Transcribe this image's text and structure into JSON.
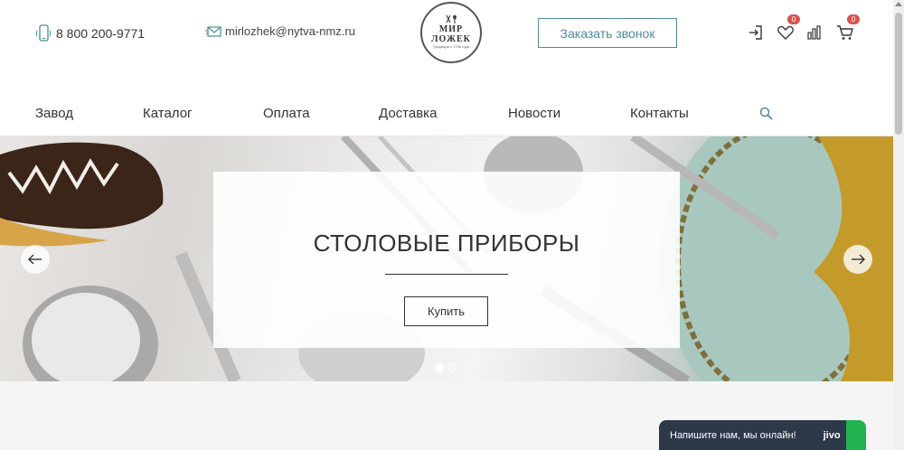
{
  "header": {
    "phone": "8 800 200-9771",
    "email": "mirlozhek@nytva-nmz.ru",
    "logo": {
      "line1": "МИР",
      "line2": "ЛОЖЕК",
      "tagline": "Традиции с 1756 года"
    },
    "callback_label": "Заказать звонок",
    "favorites_count": "0",
    "cart_count": "0"
  },
  "nav": {
    "items": [
      {
        "label": "Завод"
      },
      {
        "label": "Каталог"
      },
      {
        "label": "Оплата"
      },
      {
        "label": "Доставка"
      },
      {
        "label": "Новости"
      },
      {
        "label": "Контакты"
      }
    ]
  },
  "slider": {
    "title": "СТОЛОВЫЕ ПРИБОРЫ",
    "button_label": "Купить",
    "active_slide": 1,
    "total_slides": 2
  },
  "chat": {
    "text": "Напишите нам, мы онлайн!",
    "brand": "jivo"
  },
  "colors": {
    "accent": "#4c8a96",
    "badge": "#d9534f",
    "chat_bg": "#2d3849",
    "chat_green": "#1fb24e"
  },
  "icons": [
    "phone-icon",
    "email-icon",
    "login-icon",
    "heart-icon",
    "compare-icon",
    "cart-icon",
    "search-icon",
    "arrow-left-icon",
    "arrow-right-icon"
  ]
}
